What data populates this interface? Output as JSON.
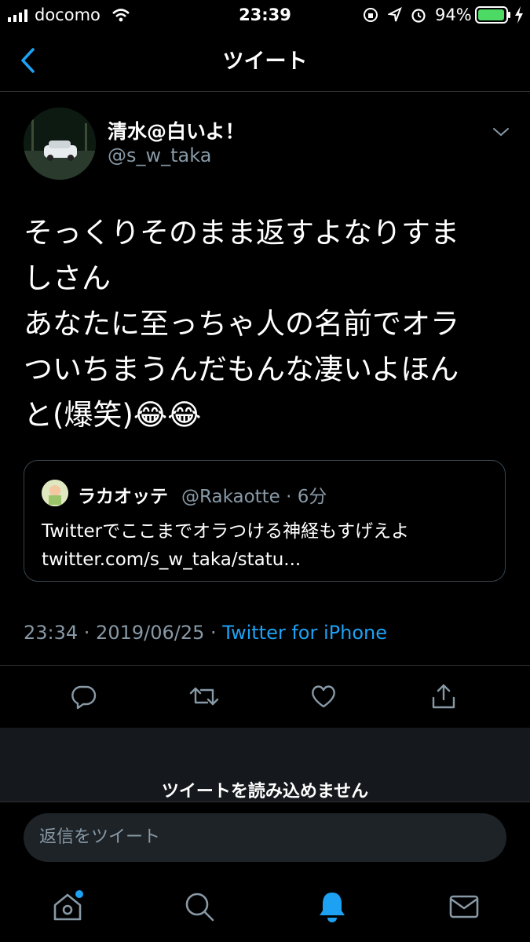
{
  "status_bar": {
    "carrier": "docomo",
    "time": "23:39",
    "battery": "94%"
  },
  "nav": {
    "title": "ツイート"
  },
  "tweet": {
    "display_name": "清水@白いよ！",
    "handle": "@s_w_taka",
    "text": "そっくりそのまま返すよなりすま\nしさん\nあなたに至っちゃ人の名前でオラ\nついちまうんだもんな凄いよほん\nと(爆笑)😂😂",
    "timestamp": "23:34 · 2019/06/25 · ",
    "source": "Twitter for iPhone"
  },
  "quote": {
    "name": "ラカオッテ",
    "meta": "@Rakaotte · 6分",
    "text": "Twitterでここまでオラつける神経もすげえよ\ntwitter.com/s_w_taka/statu..."
  },
  "unavailable_text": "ツイートを読み込めません",
  "reply": {
    "placeholder": "返信をツイート"
  },
  "colors": {
    "accent": "#1da1f2",
    "secondary_text": "#8899a6",
    "background": "#000000"
  }
}
